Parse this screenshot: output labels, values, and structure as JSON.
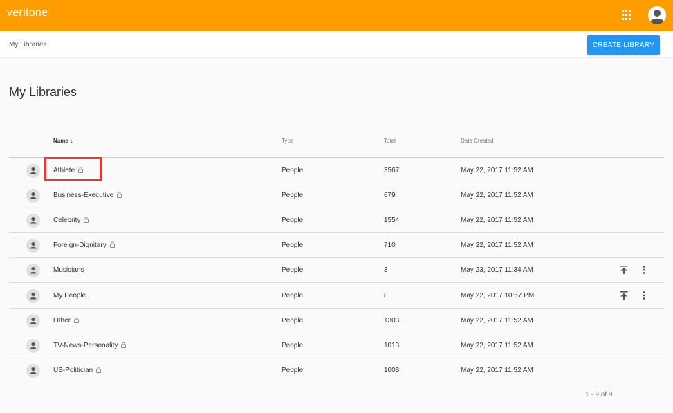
{
  "header": {
    "logo": "veritone",
    "apps_icon": "apps-grid-icon",
    "avatar_icon": "user-avatar-icon",
    "bar_color": "#ff9c00"
  },
  "subheader": {
    "breadcrumb": "My Libraries",
    "create_button": "CREATE LIBRARY",
    "button_color": "#2196f3"
  },
  "main": {
    "title": "My Libraries",
    "columns": {
      "name": "Name",
      "type": "Type",
      "total": "Total",
      "date": "Date Created"
    },
    "rows": [
      {
        "name": "Athlete",
        "locked": true,
        "type": "People",
        "total": "3567",
        "date": "May 22, 2017 11:52 AM",
        "actions": false
      },
      {
        "name": "Business-Executive",
        "locked": true,
        "type": "People",
        "total": "679",
        "date": "May 22, 2017 11:52 AM",
        "actions": false
      },
      {
        "name": "Celebrity",
        "locked": true,
        "type": "People",
        "total": "1554",
        "date": "May 22, 2017 11:52 AM",
        "actions": false
      },
      {
        "name": "Foreign-Dignitary",
        "locked": true,
        "type": "People",
        "total": "710",
        "date": "May 22, 2017 11:52 AM",
        "actions": false
      },
      {
        "name": "Musicians",
        "locked": false,
        "type": "People",
        "total": "3",
        "date": "May 23, 2017 11:34 AM",
        "actions": true
      },
      {
        "name": "My People",
        "locked": false,
        "type": "People",
        "total": "8",
        "date": "May 22, 2017 10:57 PM",
        "actions": true
      },
      {
        "name": "Other",
        "locked": true,
        "type": "People",
        "total": "1303",
        "date": "May 22, 2017 11:52 AM",
        "actions": false
      },
      {
        "name": "TV-News-Personality",
        "locked": true,
        "type": "People",
        "total": "1013",
        "date": "May 22, 2017 11:52 AM",
        "actions": false
      },
      {
        "name": "US-Politician",
        "locked": true,
        "type": "People",
        "total": "1003",
        "date": "May 22, 2017 11:52 AM",
        "actions": false
      }
    ],
    "pagination": "1 - 9 of 9",
    "highlight_color": "#e53935"
  }
}
